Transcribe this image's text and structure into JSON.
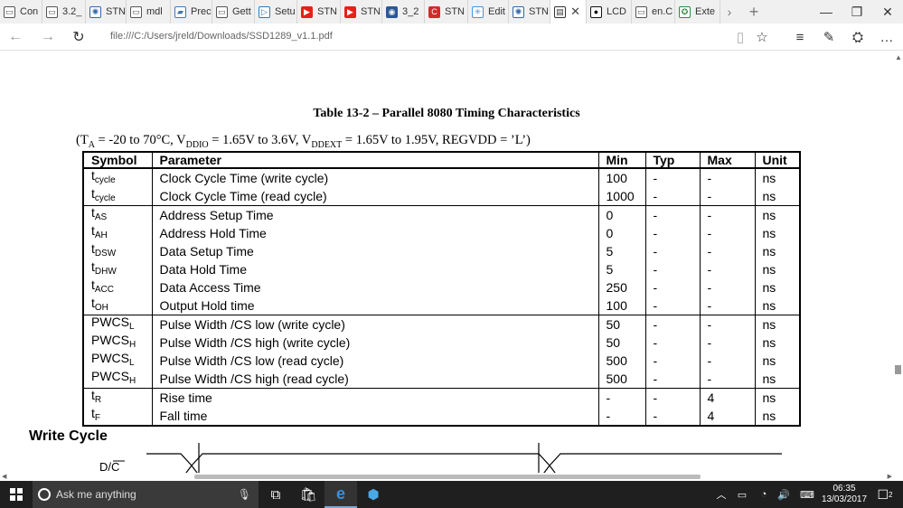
{
  "browser": {
    "tabs": [
      {
        "label": "Con",
        "icon": "page-icon"
      },
      {
        "label": "3.2_",
        "icon": "page-icon"
      },
      {
        "label": "STN",
        "icon": "chip-icon"
      },
      {
        "label": "mdl",
        "icon": "page-icon"
      },
      {
        "label": "Prec",
        "icon": "lab-icon"
      },
      {
        "label": "Gett",
        "icon": "page-icon"
      },
      {
        "label": "Setu",
        "icon": "bookmark-icon"
      },
      {
        "label": "STN",
        "icon": "youtube-icon"
      },
      {
        "label": "STN",
        "icon": "youtube-icon"
      },
      {
        "label": "3_2",
        "icon": "shield-icon"
      },
      {
        "label": "STN",
        "icon": "red-c-icon"
      },
      {
        "label": "Edit",
        "icon": "star-icon"
      },
      {
        "label": "STN",
        "icon": "chip-icon"
      },
      {
        "label": "",
        "icon": "pdf-icon"
      },
      {
        "label": "LCD",
        "icon": "github-icon"
      },
      {
        "label": "en.C",
        "icon": "page-icon"
      },
      {
        "label": "Exte",
        "icon": "extension-icon"
      }
    ],
    "url": "file:///C:/Users/jreld/Downloads/SSD1289_v1.1.pdf"
  },
  "document": {
    "table_title": "Table 13-2 – Parallel 8080 Timing Characteristics",
    "conditions": {
      "ta": "(T",
      "ta_sub": "A",
      "part1": " = -20 to 70°C, V",
      "vddio_sub": "DDIO",
      "part2": " = 1.65V to 3.6V, V",
      "vddext_sub": "DDEXT",
      "part3": " = 1.65V to 1.95V, REGVDD = ’L’)"
    },
    "headers": [
      "Symbol",
      "Parameter",
      "Min",
      "Typ",
      "Max",
      "Unit"
    ],
    "rows": [
      {
        "sym": "t",
        "sub": "cycle",
        "param": "Clock Cycle Time (write cycle)",
        "min": "100",
        "typ": "-",
        "max": "-",
        "unit": "ns"
      },
      {
        "sym": "t",
        "sub": "cycle",
        "param": "Clock Cycle Time (read cycle)",
        "min": "1000",
        "typ": "-",
        "max": "-",
        "unit": "ns"
      },
      {
        "sym": "t",
        "sub": "AS",
        "param": "Address Setup Time",
        "min": "0",
        "typ": "-",
        "max": "-",
        "unit": "ns"
      },
      {
        "sym": "t",
        "sub": "AH",
        "param": "Address Hold Time",
        "min": "0",
        "typ": "-",
        "max": "-",
        "unit": "ns"
      },
      {
        "sym": "t",
        "sub": "DSW",
        "param": "Data Setup Time",
        "min": "5",
        "typ": "-",
        "max": "-",
        "unit": "ns"
      },
      {
        "sym": "t",
        "sub": "DHW",
        "param": "Data Hold Time",
        "min": "5",
        "typ": "-",
        "max": "-",
        "unit": "ns"
      },
      {
        "sym": "t",
        "sub": "ACC",
        "param": "Data Access Time",
        "min": "250",
        "typ": "-",
        "max": "-",
        "unit": "ns"
      },
      {
        "sym": "t",
        "sub": "OH",
        "param": "Output Hold time",
        "min": "100",
        "typ": "-",
        "max": "-",
        "unit": "ns"
      },
      {
        "sym": "PWCS",
        "sub": "L",
        "param": "Pulse Width /CS low (write cycle)",
        "min": "50",
        "typ": "-",
        "max": "-",
        "unit": "ns"
      },
      {
        "sym": "PWCS",
        "sub": "H",
        "param": "Pulse Width /CS high (write cycle)",
        "min": "50",
        "typ": "-",
        "max": "-",
        "unit": "ns"
      },
      {
        "sym": "PWCS",
        "sub": "L",
        "param": "Pulse Width /CS low (read cycle)",
        "min": "500",
        "typ": "-",
        "max": "-",
        "unit": "ns"
      },
      {
        "sym": "PWCS",
        "sub": "H",
        "param": "Pulse Width /CS high (read cycle)",
        "min": "500",
        "typ": "-",
        "max": "-",
        "unit": "ns"
      },
      {
        "sym": "t",
        "sub": "R",
        "param": "Rise time",
        "min": "-",
        "typ": "-",
        "max": "4",
        "unit": "ns"
      },
      {
        "sym": "t",
        "sub": "F",
        "param": "Fall time",
        "min": "-",
        "typ": "-",
        "max": "4",
        "unit": "ns"
      }
    ],
    "write_cycle_heading": "Write Cycle",
    "signal_label": "D/C"
  },
  "taskbar": {
    "search_placeholder": "Ask me anything",
    "time": "06:35",
    "date": "13/03/2017",
    "notification_count": "2"
  }
}
